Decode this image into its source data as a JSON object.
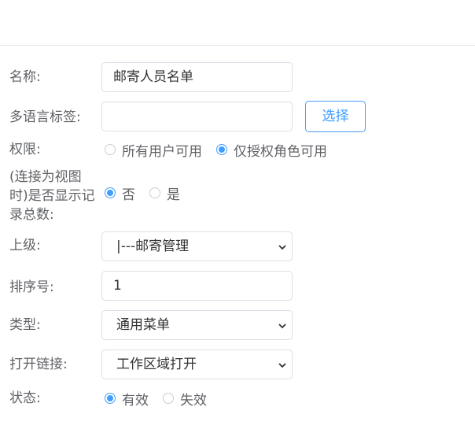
{
  "form": {
    "name": {
      "label": "名称:",
      "value": "邮寄人员名单"
    },
    "i18n": {
      "label": "多语言标签:",
      "value": "",
      "button": "选择"
    },
    "permission": {
      "label": "权限:",
      "options": [
        "所有用户可用",
        "仅授权角色可用"
      ],
      "selected": 1
    },
    "count": {
      "label_lines": [
        "(连接为视图",
        "时)是否显示记",
        "录总数:"
      ],
      "options": [
        "否",
        "是"
      ],
      "selected": 0
    },
    "parent": {
      "label": "上级:",
      "value": "|---邮寄管理"
    },
    "order": {
      "label": "排序号:",
      "value": "1"
    },
    "type": {
      "label": "类型:",
      "value": "通用菜单"
    },
    "open": {
      "label": "打开链接:",
      "value": "工作区域打开"
    },
    "status": {
      "label": "状态:",
      "options": [
        "有效",
        "失效"
      ],
      "selected": 0
    }
  },
  "colors": {
    "accent": "#409eff",
    "border": "#dcdfe6",
    "text": "#606266"
  },
  "icons": {
    "select_arrow": "chevron-down-icon"
  }
}
